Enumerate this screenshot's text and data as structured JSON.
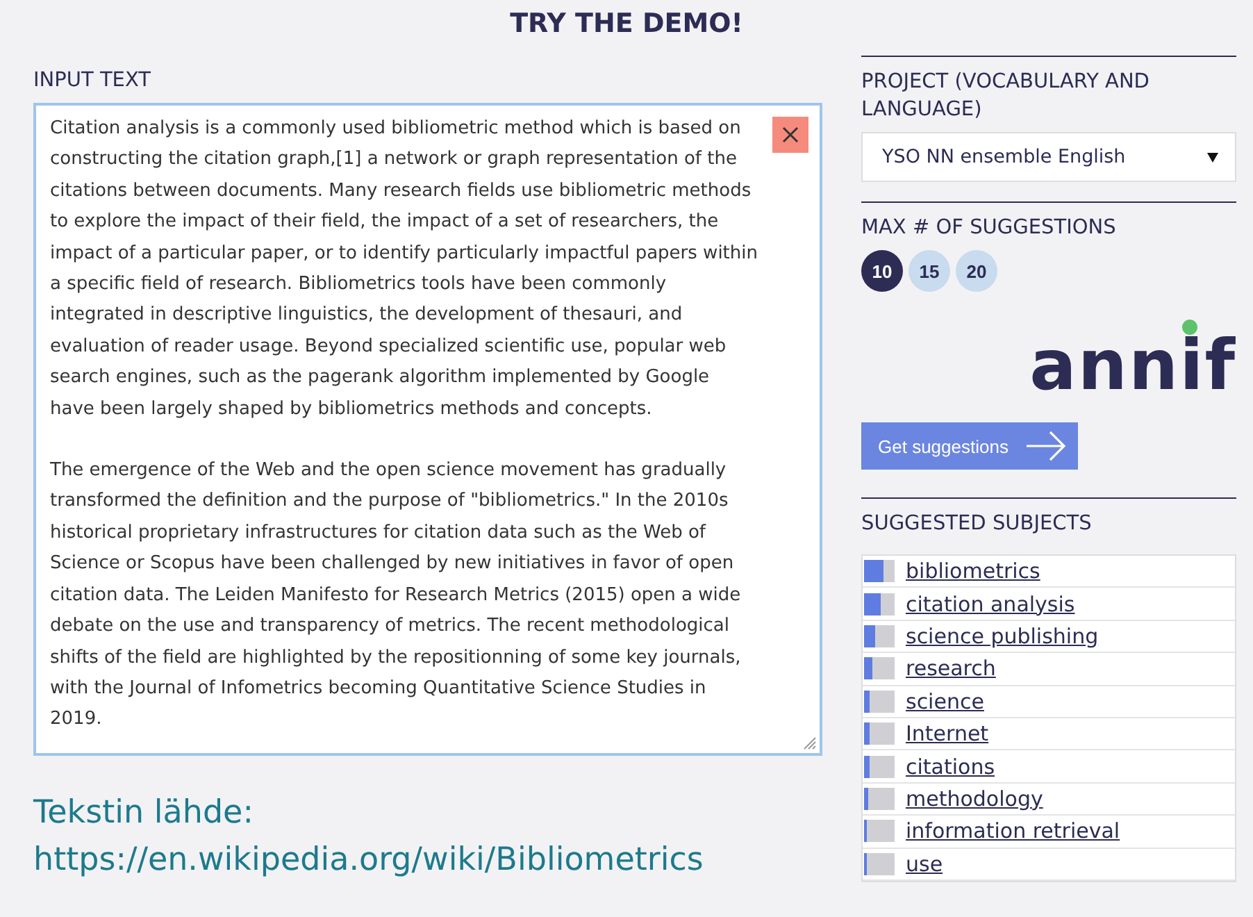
{
  "title": "TRY THE DEMO!",
  "input": {
    "label": "INPUT TEXT",
    "paragraphs": [
      "Citation analysis is a commonly used bibliometric method which is based on constructing the citation graph,[1] a network or graph representation of the citations between documents. Many research fields use bibliometric methods to explore the impact of their field, the impact of a set of researchers, the impact of a particular paper, or to identify particularly impactful papers within a specific field of research. Bibliometrics tools have been commonly integrated in descriptive linguistics, the development of thesauri, and evaluation of reader usage. Beyond specialized scientific use, popular web search engines, such as the pagerank algorithm implemented by Google have been largely shaped by bibliometrics methods and concepts.",
      "The emergence of the Web and the open science movement has gradually transformed the definition and the purpose of \"bibliometrics.\" In the 2010s historical proprietary infrastructures for citation data such as the Web of Science or Scopus have been challenged by new initiatives in favor of open citation data. The Leiden Manifesto for Research Metrics (2015) open a wide debate on the use and transparency of metrics. The recent methodological shifts of the field are highlighted by the repositionning of some key journals, with the Journal of Infometrics becoming Quantitative Science Studies in 2019."
    ]
  },
  "source": {
    "label": "Tekstin lähde:",
    "url": "https://en.wikipedia.org/wiki/Bibliometrics"
  },
  "project": {
    "label": "PROJECT (VOCABULARY AND LANGUAGE)",
    "value": "YSO NN ensemble English"
  },
  "max_suggestions": {
    "label": "MAX # OF SUGGESTIONS",
    "options": [
      {
        "label": "10",
        "selected": true
      },
      {
        "label": "15",
        "selected": false
      },
      {
        "label": "20",
        "selected": false
      }
    ]
  },
  "logo": "annif",
  "button": "Get suggestions",
  "suggested": {
    "label": "SUGGESTED SUBJECTS",
    "items": [
      {
        "label": "bibliometrics",
        "level": 0.65
      },
      {
        "label": "citation analysis",
        "level": 0.55
      },
      {
        "label": "science publishing",
        "level": 0.38
      },
      {
        "label": "research",
        "level": 0.28
      },
      {
        "label": "science",
        "level": 0.18
      },
      {
        "label": "Internet",
        "level": 0.17
      },
      {
        "label": "citations",
        "level": 0.16
      },
      {
        "label": "methodology",
        "level": 0.12
      },
      {
        "label": "information retrieval",
        "level": 0.1
      },
      {
        "label": "use",
        "level": 0.08
      }
    ]
  }
}
